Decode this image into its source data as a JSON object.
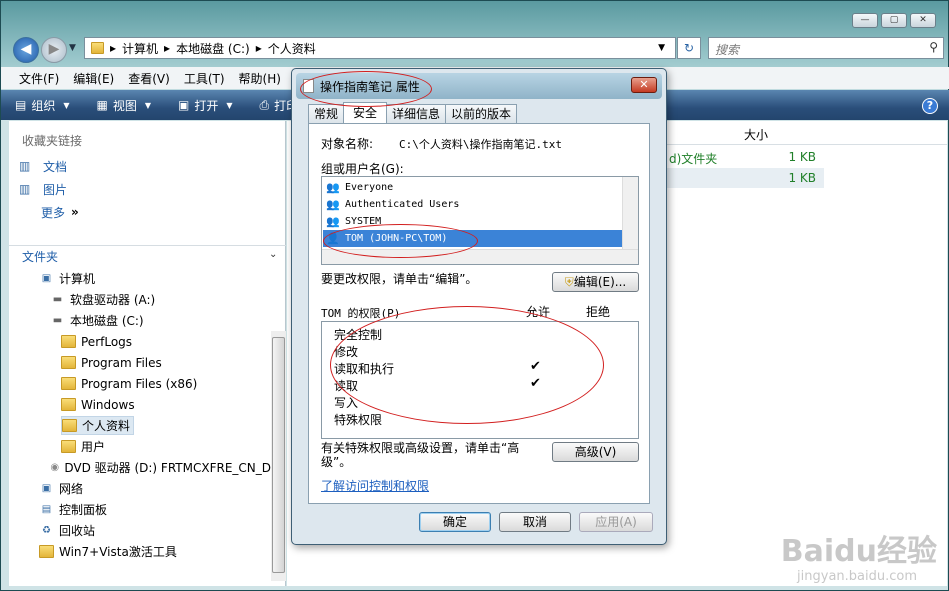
{
  "window": {
    "min": "—",
    "max": "▢",
    "close": "✕"
  },
  "address": {
    "path": [
      "计算机",
      "本地磁盘 (C:)",
      "个人资料"
    ],
    "search_placeholder": "搜索"
  },
  "menu": [
    "文件(F)",
    "编辑(E)",
    "查看(V)",
    "工具(T)",
    "帮助(H)"
  ],
  "toolbar": [
    {
      "label": "组织",
      "icon": "organize-icon"
    },
    {
      "label": "视图",
      "icon": "views-icon"
    },
    {
      "label": "打开",
      "icon": "open-icon"
    },
    {
      "label": "打印",
      "icon": "print-icon"
    }
  ],
  "nav": {
    "favorites_header": "收藏夹链接",
    "favorites": [
      "文档",
      "图片",
      "更多"
    ],
    "folders_header": "文件夹",
    "tree": [
      {
        "label": "计算机",
        "icon": "computer-icon"
      },
      {
        "label": "软盘驱动器 (A:)",
        "icon": "floppy-icon"
      },
      {
        "label": "本地磁盘 (C:)",
        "icon": "drive-icon"
      },
      {
        "label": "PerfLogs",
        "icon": "folder-icon"
      },
      {
        "label": "Program Files",
        "icon": "folder-icon"
      },
      {
        "label": "Program Files (x86)",
        "icon": "folder-icon"
      },
      {
        "label": "Windows",
        "icon": "folder-icon"
      },
      {
        "label": "个人资料",
        "icon": "folder-icon"
      },
      {
        "label": "用户",
        "icon": "folder-icon"
      },
      {
        "label": "DVD 驱动器 (D:) FRTMCXFRE_CN_D",
        "icon": "dvd-icon"
      },
      {
        "label": "网络",
        "icon": "network-icon"
      },
      {
        "label": "控制面板",
        "icon": "control-panel-icon"
      },
      {
        "label": "回收站",
        "icon": "recycle-bin-icon"
      },
      {
        "label": "Win7+Vista激活工具",
        "icon": "folder-icon"
      }
    ]
  },
  "list": {
    "size_header": "大小",
    "rows": [
      {
        "type": "d)文件夹",
        "size": "1 KB"
      },
      {
        "type": "",
        "size": "1 KB"
      }
    ]
  },
  "dialog": {
    "title": "操作指南笔记 属性",
    "tabs": [
      "常规",
      "安全",
      "详细信息",
      "以前的版本"
    ],
    "object_label": "对象名称:",
    "object_value": "C:\\个人资料\\操作指南笔记.txt",
    "groups_label": "组或用户名(G):",
    "users": [
      "Everyone",
      "Authenticated Users",
      "SYSTEM",
      "TOM (JOHN-PC\\TOM)"
    ],
    "edit_hint": "要更改权限，请单击“编辑”。",
    "edit_button": "编辑(E)...",
    "perm_label": "TOM 的权限(P)",
    "allow": "允许",
    "deny": "拒绝",
    "permissions": [
      {
        "name": "完全控制",
        "allow": ""
      },
      {
        "name": "修改",
        "allow": ""
      },
      {
        "name": "读取和执行",
        "allow": "✔"
      },
      {
        "name": "读取",
        "allow": "✔"
      },
      {
        "name": "写入",
        "allow": ""
      },
      {
        "name": "特殊权限",
        "allow": ""
      }
    ],
    "advanced_hint": "有关特殊权限或高级设置，请单击“高级”。",
    "advanced_button": "高级(V)",
    "learn_link": "了解访问控制和权限",
    "ok": "确定",
    "cancel": "取消",
    "apply": "应用(A)"
  },
  "watermark": {
    "brand": "Baidu经验",
    "url": "jingyan.baidu.com"
  }
}
